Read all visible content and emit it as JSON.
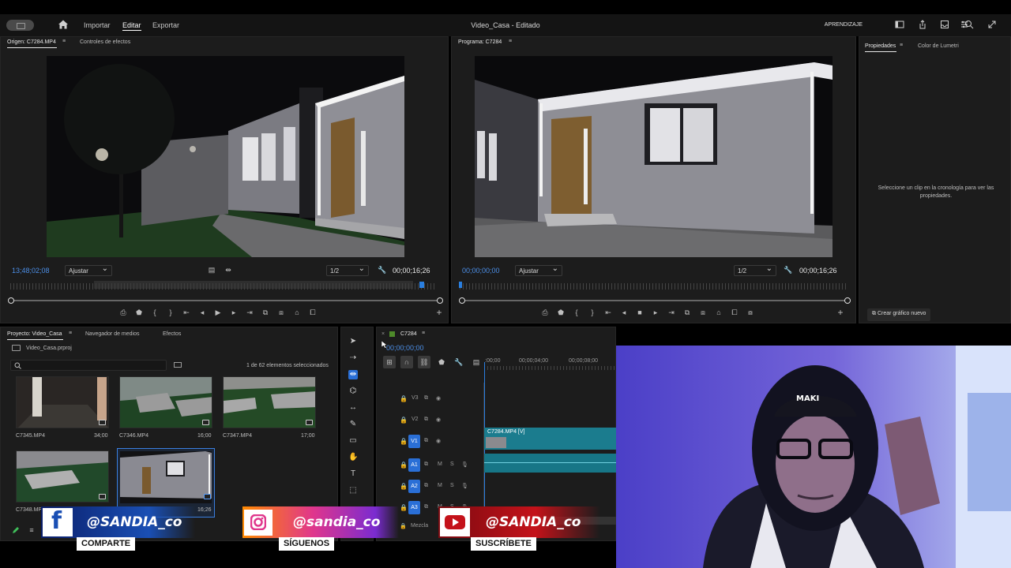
{
  "app": {
    "nav": [
      "Importar",
      "Editar",
      "Exportar"
    ],
    "active_nav": "Editar",
    "title": "Video_Casa - Editado",
    "learn": "APRENDIZAJE"
  },
  "source_monitor": {
    "tabs": [
      "Origen: C7284.MP4",
      "Controles de efectos"
    ],
    "timecode_in": "13;48;02;08",
    "fit": "Ajustar",
    "resolution": "1/2",
    "duration": "00;00;16;26"
  },
  "program_monitor": {
    "tab": "Programa: C7284",
    "timecode_in": "00;00;00;00",
    "fit": "Ajustar",
    "resolution": "1/2",
    "duration": "00;00;16;26"
  },
  "properties": {
    "tabs": [
      "Propiedades",
      "Color de Lumetri"
    ],
    "message": "Seleccione un clip en la cronología para ver las propiedades.",
    "new_graphic": "Crear gráfico nuevo"
  },
  "project": {
    "tabs": [
      "Proyecto: Video_Casa",
      "Navegador de medios",
      "Efectos"
    ],
    "file": "Video_Casa.prproj",
    "selection_count": "1 de 62 elementos seleccionados",
    "clips": [
      {
        "name": "C7345.MP4",
        "duration": "34;00"
      },
      {
        "name": "C7346.MP4",
        "duration": "16;00"
      },
      {
        "name": "C7347.MP4",
        "duration": "17;00"
      },
      {
        "name": "C7348.MP4",
        "duration": ""
      },
      {
        "name": "",
        "duration": "16;26"
      }
    ]
  },
  "timeline": {
    "sequence": "C7284",
    "timecode": "00;00;00;00",
    "ruler": [
      ":00;00",
      "00;00;04;00",
      "00;00;08;00"
    ],
    "video_tracks": [
      "V3",
      "V2",
      "V1"
    ],
    "audio_tracks": [
      "A1",
      "A2",
      "A3"
    ],
    "mix_label": "Mezcla",
    "clip_label": "C7284.MP4 [V]",
    "audio_letters": [
      "M",
      "S"
    ]
  },
  "social": {
    "facebook": {
      "handle": "@SANDIA_co",
      "cta": "COMPARTE",
      "color": "#1a4fb4"
    },
    "instagram": {
      "handle": "@sandia_co",
      "cta": "SÍGUENOS",
      "color": "#e0368c"
    },
    "youtube": {
      "handle": "@SANDIA_co",
      "cta": "SUSCRÍBETE",
      "color": "#c4121a"
    }
  },
  "webcam": {
    "cap_text": "MAKI"
  }
}
